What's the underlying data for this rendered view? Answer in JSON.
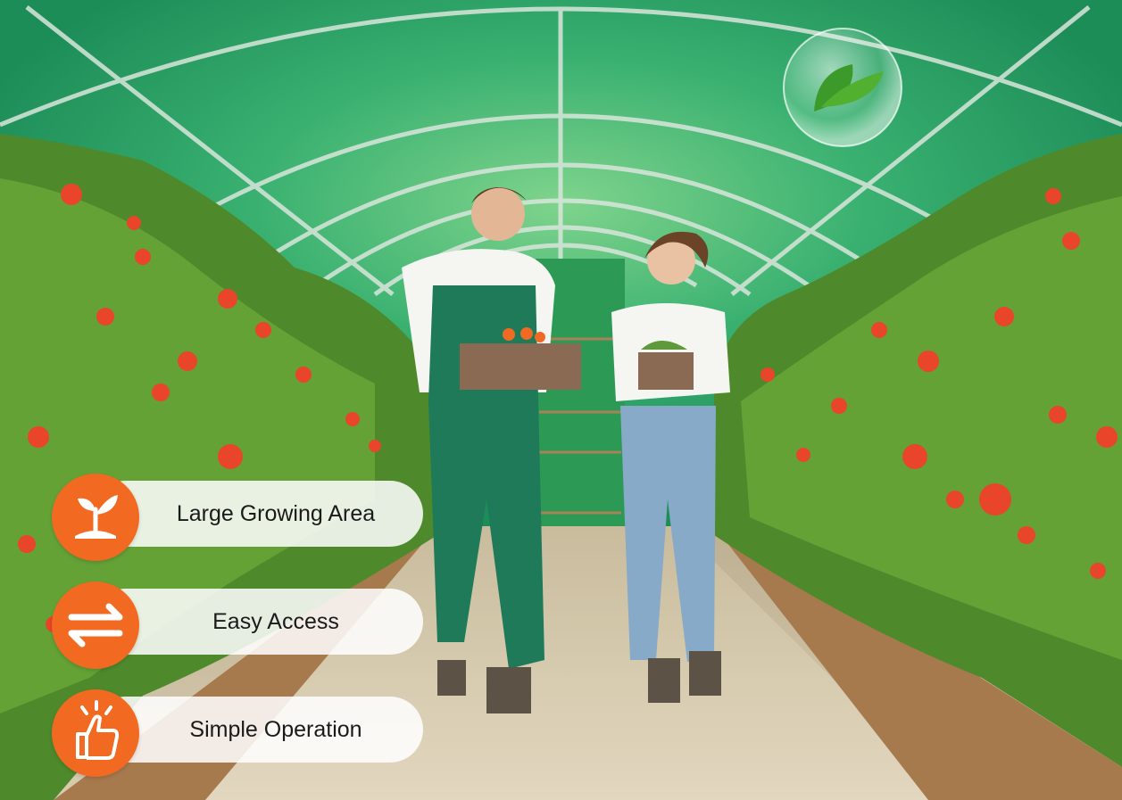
{
  "features": {
    "items": [
      {
        "label": "Large Growing Area",
        "icon": "sprout-icon"
      },
      {
        "label": "Easy Access",
        "icon": "two-way-arrows-icon"
      },
      {
        "label": "Simple Operation",
        "icon": "thumbs-up-icon"
      }
    ],
    "badge_color": "#f26a21"
  },
  "scene": {
    "accent_colors": {
      "greenhouse": "#2fa86a",
      "tomato": "#e8452a",
      "path": "#d8cbb0",
      "soil_bed": "#a77a4e"
    }
  }
}
